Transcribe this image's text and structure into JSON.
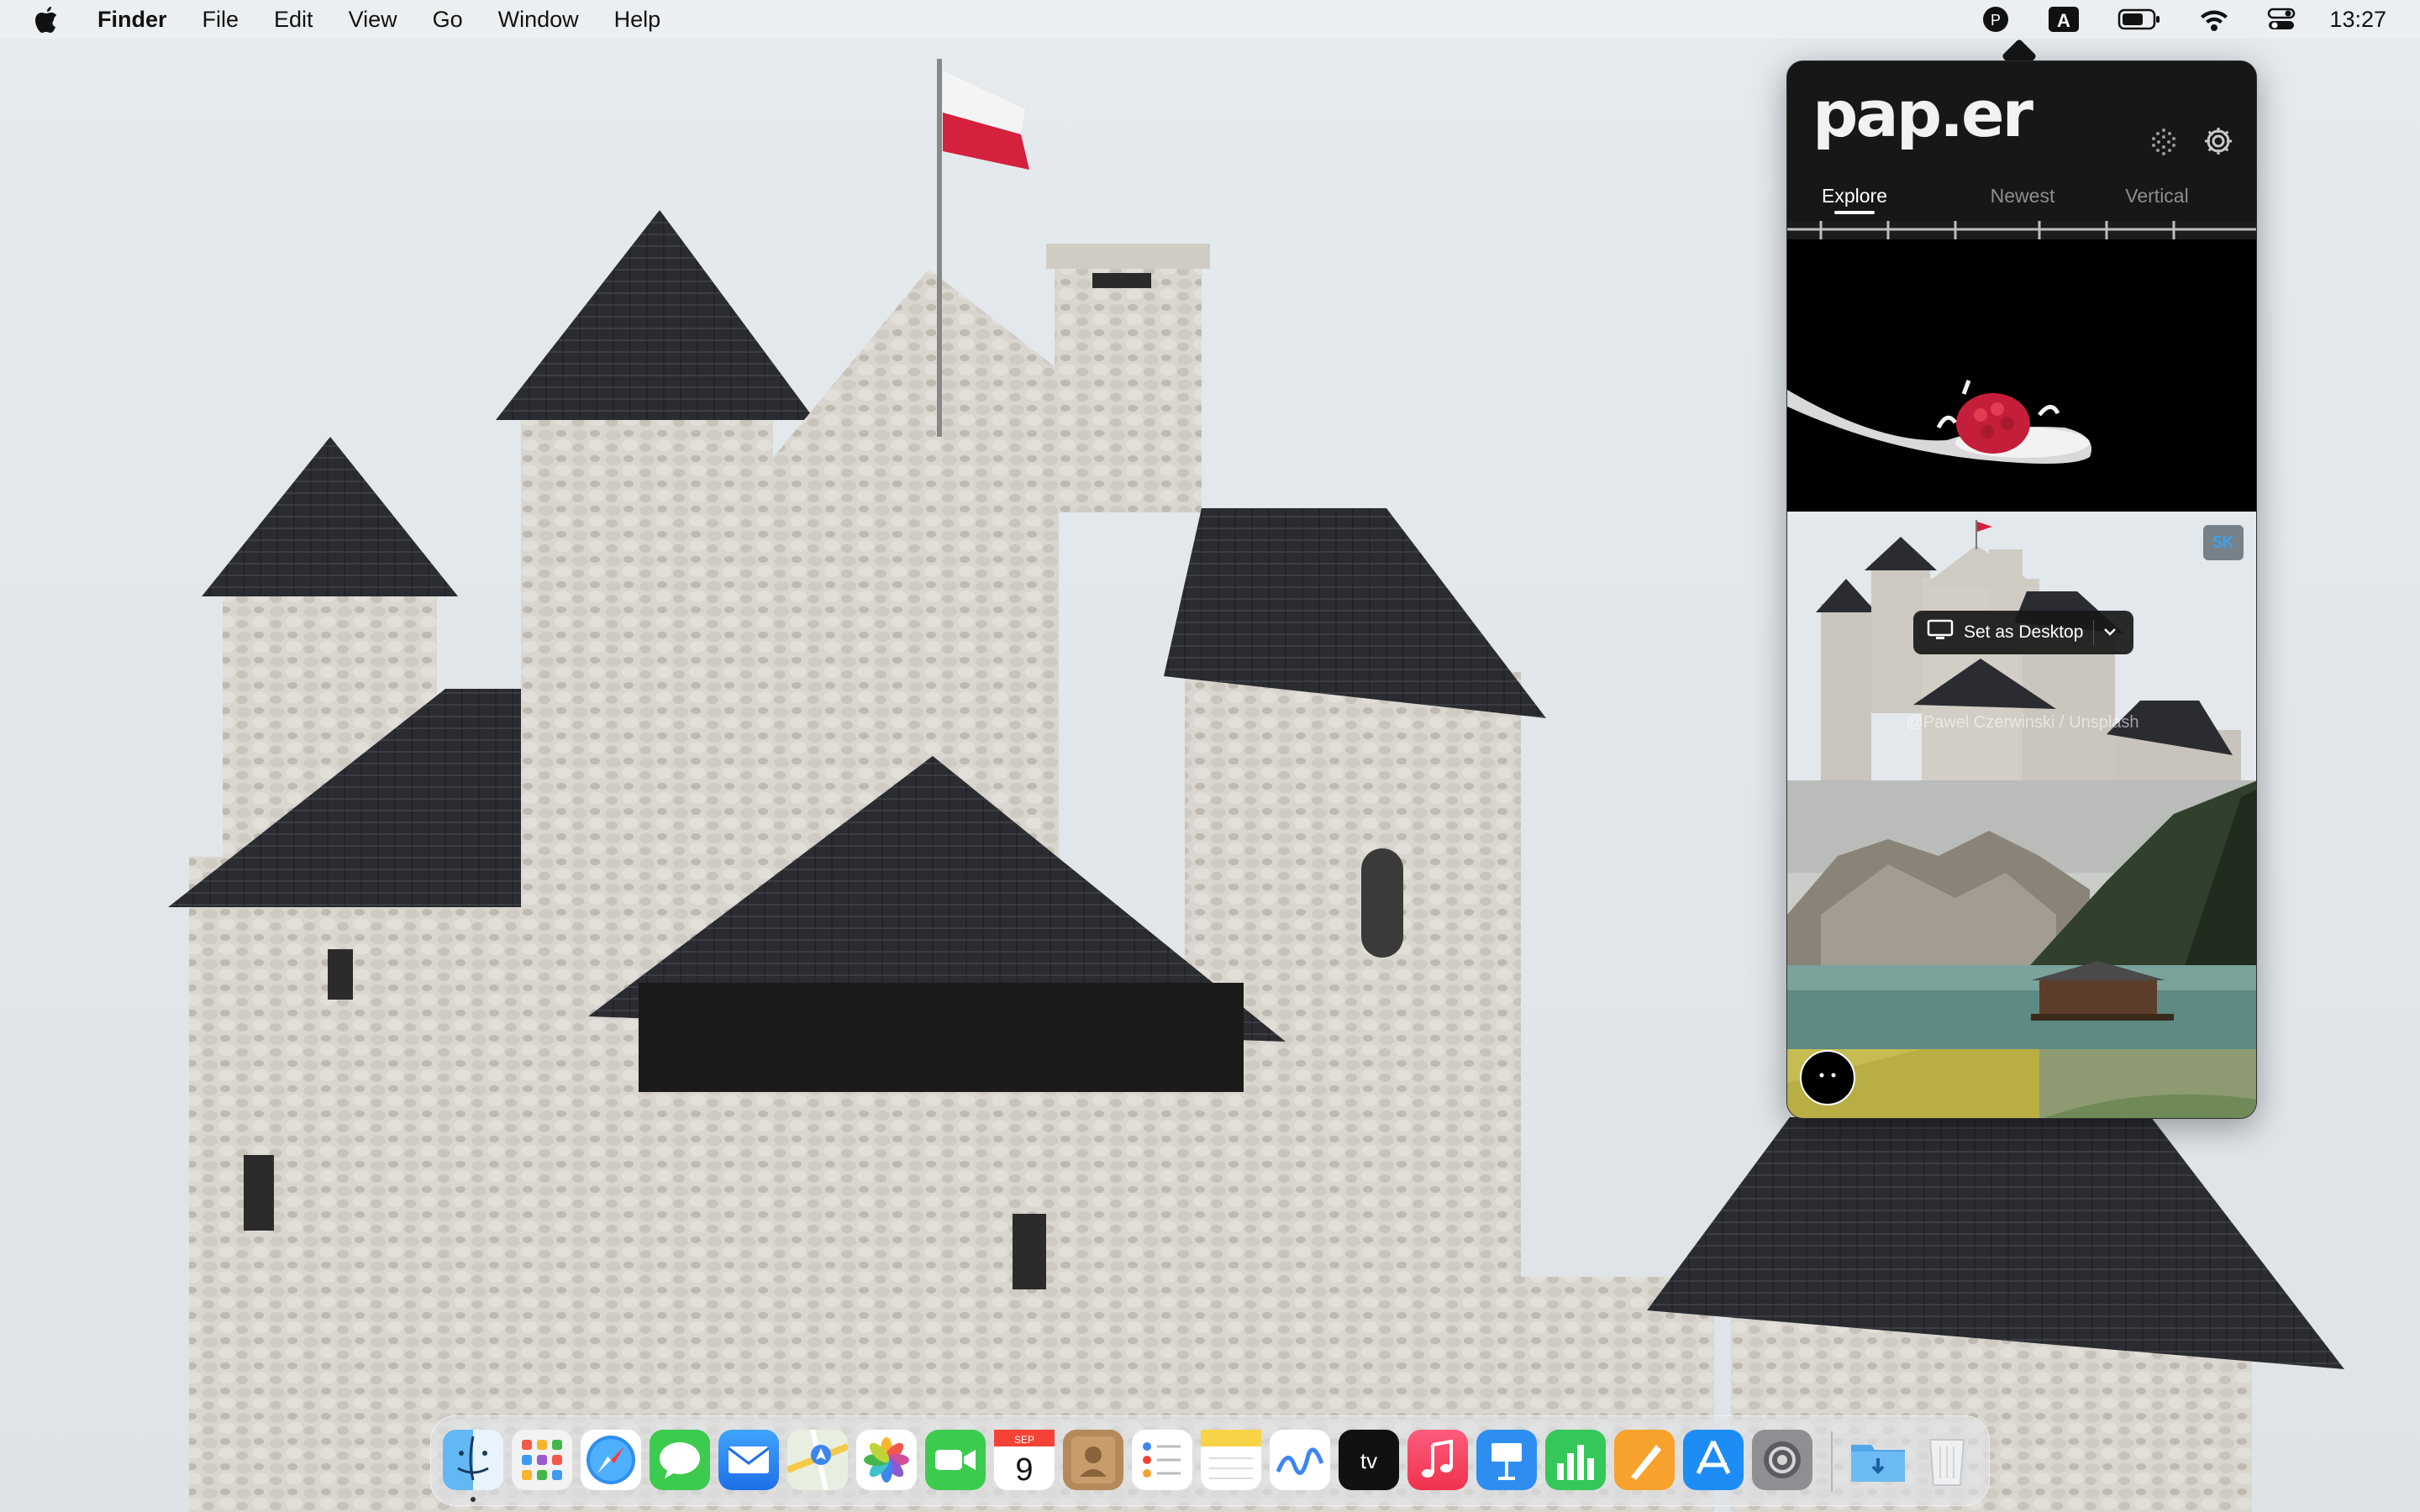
{
  "menubar": {
    "app_name": "Finder",
    "menus": [
      "File",
      "Edit",
      "View",
      "Go",
      "Window",
      "Help"
    ],
    "clock": "13:27",
    "input_source": "A"
  },
  "paper_app": {
    "logo": "pap.er",
    "tabs": [
      {
        "label": "Explore",
        "active": true
      },
      {
        "label": "Newest",
        "active": false
      },
      {
        "label": "Vertical",
        "active": false
      }
    ],
    "selected_wallpaper": {
      "resolution_badge": "5K",
      "set_button_label": "Set as Desktop",
      "credit": "@Pawel Czerwinski / Unsplash"
    }
  },
  "dock": {
    "apps": [
      "Finder",
      "Launchpad",
      "Safari",
      "Messages",
      "Mail",
      "Maps",
      "Photos",
      "FaceTime",
      "Calendar",
      "Contacts",
      "Reminders",
      "Notes",
      "Freeform",
      "TV",
      "Music",
      "Keynote",
      "Numbers",
      "Pages",
      "App Store",
      "System Settings",
      "Downloads",
      "Trash"
    ],
    "calendar": {
      "month": "SEP",
      "day": "9"
    }
  },
  "colors": {
    "popover_bg": "#161616",
    "badge_text": "#3ea0e8",
    "flag_red": "#d4213d"
  }
}
